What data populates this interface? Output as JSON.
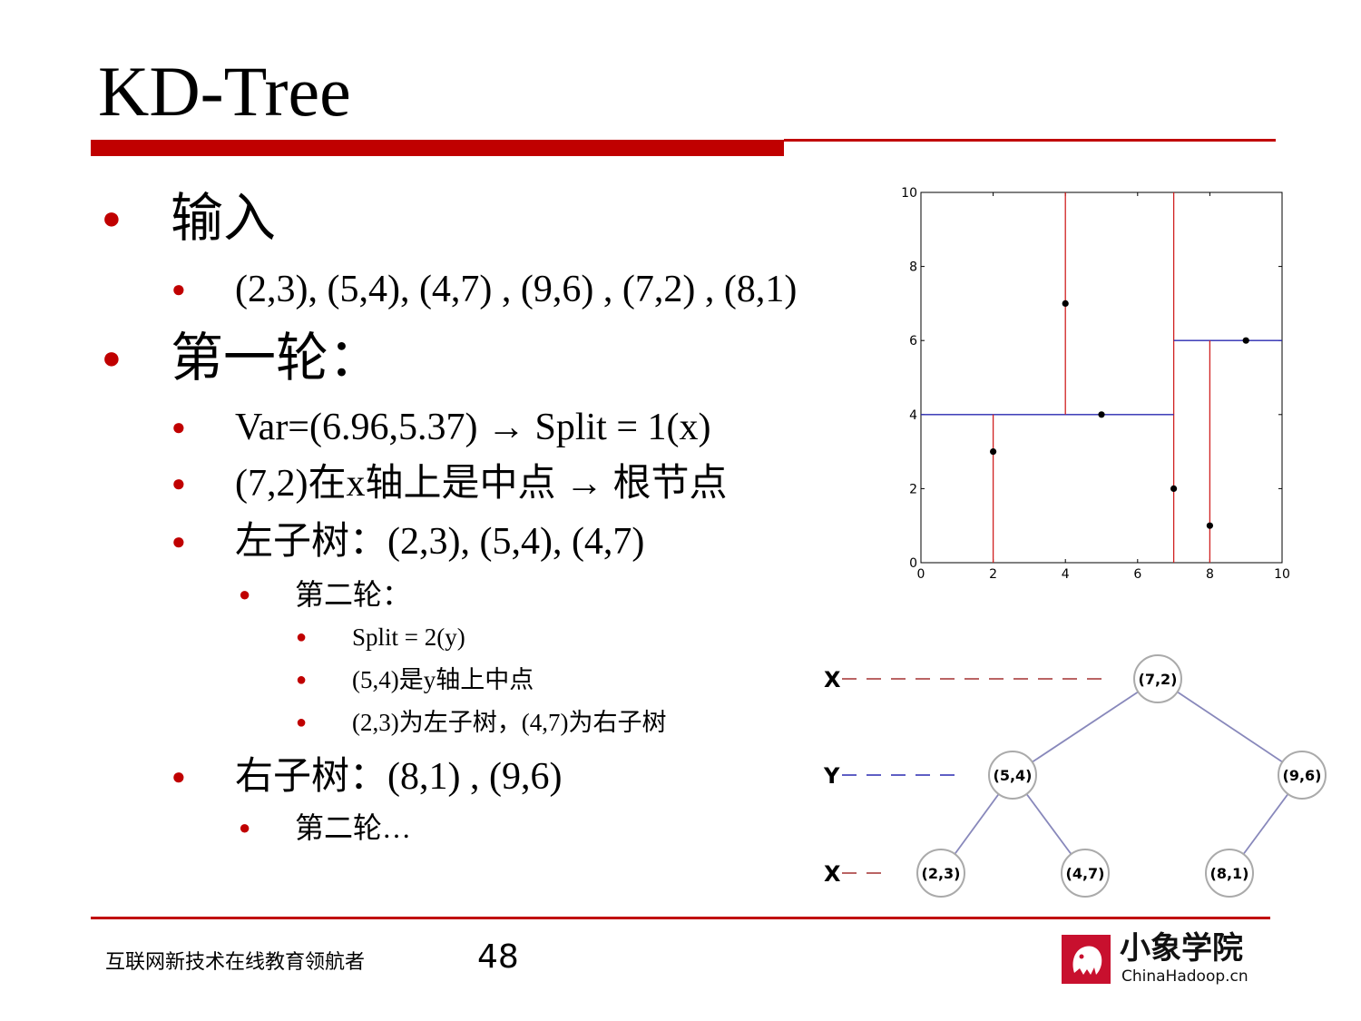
{
  "slide": {
    "title": "KD-Tree",
    "bullets": [
      {
        "text": "输入",
        "level": 1
      },
      {
        "text": "(2,3), (5,4), (4,7) , (9,6) , (7,2) , (8,1)",
        "level": 2
      },
      {
        "text": "第一轮：",
        "level": 1
      },
      {
        "text": "Var=(6.96,5.37) → Split = 1(x)",
        "level": 2
      },
      {
        "text": "(7,2)在x轴上是中点 → 根节点",
        "level": 2
      },
      {
        "text": "左子树：(2,3), (5,4), (4,7)",
        "level": 2
      },
      {
        "text": "第二轮：",
        "level": 3
      },
      {
        "text": "Split = 2(y)",
        "level": 4
      },
      {
        "text": "(5,4)是y轴上中点",
        "level": 4
      },
      {
        "text": "(2,3)为左子树，(4,7)为右子树",
        "level": 4
      },
      {
        "text": "右子树：(8,1) , (9,6)",
        "level": 2
      },
      {
        "text": "第二轮…",
        "level": 3
      }
    ]
  },
  "chart_data": {
    "type": "scatter",
    "x": [
      2,
      5,
      4,
      9,
      7,
      8
    ],
    "y": [
      3,
      4,
      7,
      6,
      2,
      1
    ],
    "xlim": [
      0,
      10
    ],
    "ylim": [
      0,
      10
    ],
    "xticks": [
      0,
      2,
      4,
      6,
      8,
      10
    ],
    "yticks": [
      0,
      2,
      4,
      6,
      8,
      10
    ],
    "xlabel": "",
    "ylabel": "",
    "grid": false,
    "split_lines": [
      {
        "axis": "x",
        "value": 7,
        "from": 0,
        "to": 10,
        "color": "#d02020"
      },
      {
        "axis": "y",
        "value": 4,
        "from": 0,
        "to": 7,
        "color": "#2a2ab0"
      },
      {
        "axis": "x",
        "value": 2,
        "from": 0,
        "to": 4,
        "color": "#d02020"
      },
      {
        "axis": "x",
        "value": 4,
        "from": 4,
        "to": 10,
        "color": "#d02020"
      },
      {
        "axis": "y",
        "value": 6,
        "from": 7,
        "to": 10,
        "color": "#2a2ab0"
      },
      {
        "axis": "x",
        "value": 8,
        "from": 0,
        "to": 6,
        "color": "#d02020"
      }
    ]
  },
  "tree": {
    "levels": [
      {
        "label": "X",
        "color": "#a33030"
      },
      {
        "label": "Y",
        "color": "#2a2ab0"
      },
      {
        "label": "X",
        "color": "#a33030"
      }
    ],
    "nodes": [
      {
        "label": "(7,2)",
        "depth": 0
      },
      {
        "label": "(5,4)",
        "depth": 1
      },
      {
        "label": "(9,6)",
        "depth": 1
      },
      {
        "label": "(2,3)",
        "depth": 2
      },
      {
        "label": "(4,7)",
        "depth": 2
      },
      {
        "label": "(8,1)",
        "depth": 2
      }
    ],
    "edges": [
      [
        0,
        1
      ],
      [
        0,
        2
      ],
      [
        1,
        3
      ],
      [
        1,
        4
      ],
      [
        2,
        5
      ]
    ],
    "edge_color": "#8888bb"
  },
  "footer": {
    "text": "互联网新技术在线教育领航者",
    "page_number": "48",
    "logo_cn": "小象学院",
    "logo_en": "ChinaHadoop.cn"
  },
  "colors": {
    "accent": "#c00000",
    "logo_red": "#c8102e"
  }
}
